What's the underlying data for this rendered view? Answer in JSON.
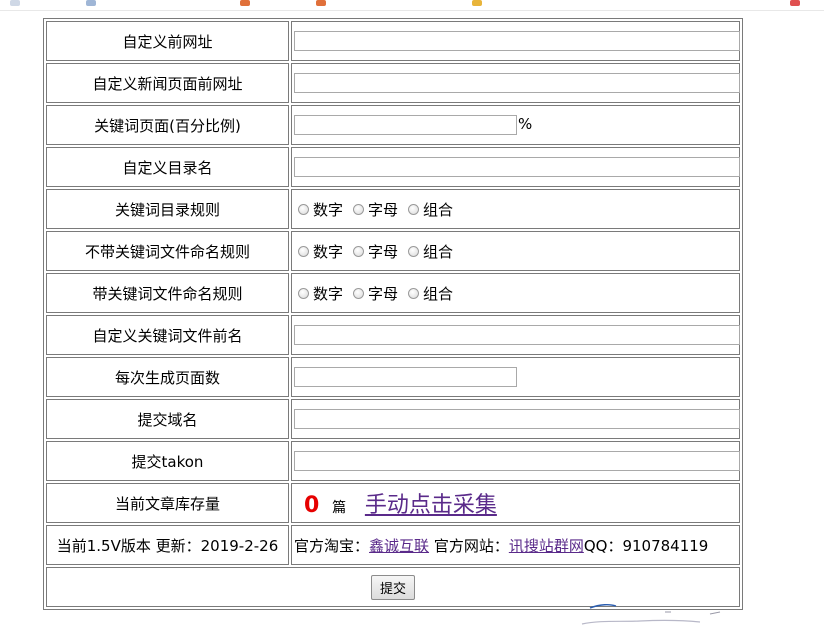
{
  "form": {
    "rows": [
      {
        "label": "自定义前网址",
        "type": "text-full",
        "value": ""
      },
      {
        "label": "自定义新闻页面前网址",
        "type": "text-full",
        "value": ""
      },
      {
        "label": "关键词页面(百分比例)",
        "type": "text-half-percent",
        "value": "",
        "suffix": "%"
      },
      {
        "label": "自定义目录名",
        "type": "text-full",
        "value": ""
      },
      {
        "label": "关键词目录规则",
        "type": "radio"
      },
      {
        "label": "不带关键词文件命名规则",
        "type": "radio"
      },
      {
        "label": "带关键词文件命名规则",
        "type": "radio"
      },
      {
        "label": "自定义关键词文件前名",
        "type": "text-full",
        "value": ""
      },
      {
        "label": "每次生成页面数",
        "type": "text-half",
        "value": ""
      },
      {
        "label": "提交域名",
        "type": "text-full",
        "value": ""
      },
      {
        "label": "提交takon",
        "type": "text-full",
        "value": ""
      }
    ],
    "radio_options": [
      "数字",
      "字母",
      "组合"
    ],
    "stock": {
      "label": "当前文章库存量",
      "count": "0",
      "unit": "篇",
      "collect_link": "手动点击采集"
    },
    "footer": {
      "version": "当前1.5V版本",
      "updated": "更新：2019-2-26",
      "taobao_label": "官方淘宝：",
      "taobao_link": "鑫诚互联",
      "site_label": "官方网站：",
      "site_link": "讯搜站群网",
      "qq": "QQ：910784119"
    },
    "submit_label": "提交"
  },
  "colors": {
    "count": "#e60000",
    "link": "#5a2a8a",
    "border": "#7a7a7a"
  }
}
